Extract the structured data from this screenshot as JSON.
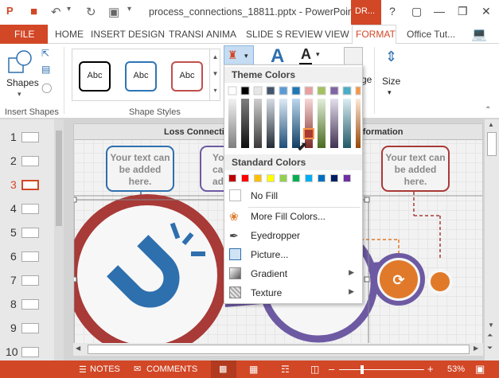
{
  "titlebar": {
    "filename": "process_connections_18811.pptx - PowerPoint",
    "draw_tab": "DR..."
  },
  "tabs": {
    "file": "FILE",
    "items": [
      "HOME",
      "INSERT",
      "DESIGN",
      "TRANSI",
      "ANIMA",
      "SLIDE S",
      "REVIEW",
      "VIEW",
      "FORMAT"
    ],
    "account": "Office Tut..."
  },
  "ribbon": {
    "shapes_label": "Shapes",
    "insert_shapes_group": "Insert Shapes",
    "shape_styles_group": "Shape Styles",
    "style_samples": [
      "Abc",
      "Abc",
      "Abc"
    ],
    "image_label_partial": "ge",
    "size_label": "Size"
  },
  "thumbnails": {
    "numbers": [
      "1",
      "2",
      "3",
      "4",
      "5",
      "6",
      "7",
      "8",
      "9",
      "10"
    ],
    "active": "3"
  },
  "slide": {
    "header_left": "Loss Connection",
    "header_right": "nformation",
    "callout_text": "Your text can be added here.",
    "callout_partial_1": "Yo",
    "callout_partial_2": "ca",
    "callout_partial_3": "ad"
  },
  "menu": {
    "theme_colors_title": "Theme Colors",
    "standard_colors_title": "Standard Colors",
    "no_fill": "No Fill",
    "more_fill_colors": "More Fill Colors...",
    "eyedropper": "Eyedropper",
    "picture": "Picture...",
    "gradient": "Gradient",
    "texture": "Texture",
    "theme_top_row": [
      "#ffffff",
      "#000000",
      "#e7e6e6",
      "#44546a",
      "#5b9bd5",
      "#1f77b4",
      "#e8a0a0",
      "#a5c15e",
      "#8064a2",
      "#4bacc6",
      "#f79646"
    ],
    "standard_row": [
      "#c00000",
      "#ff0000",
      "#ffc000",
      "#ffff00",
      "#92d050",
      "#00b050",
      "#00b0f0",
      "#0070c0",
      "#002060",
      "#7030a0"
    ]
  },
  "statusbar": {
    "notes": "NOTES",
    "comments": "COMMENTS",
    "zoom": "53%"
  },
  "colors": {
    "accent": "#d24726",
    "callout_blue": "#2e6fae",
    "ring_red": "#a83a37",
    "ring_orange": "#e07a2a",
    "ring_purple": "#6d5aa3"
  }
}
